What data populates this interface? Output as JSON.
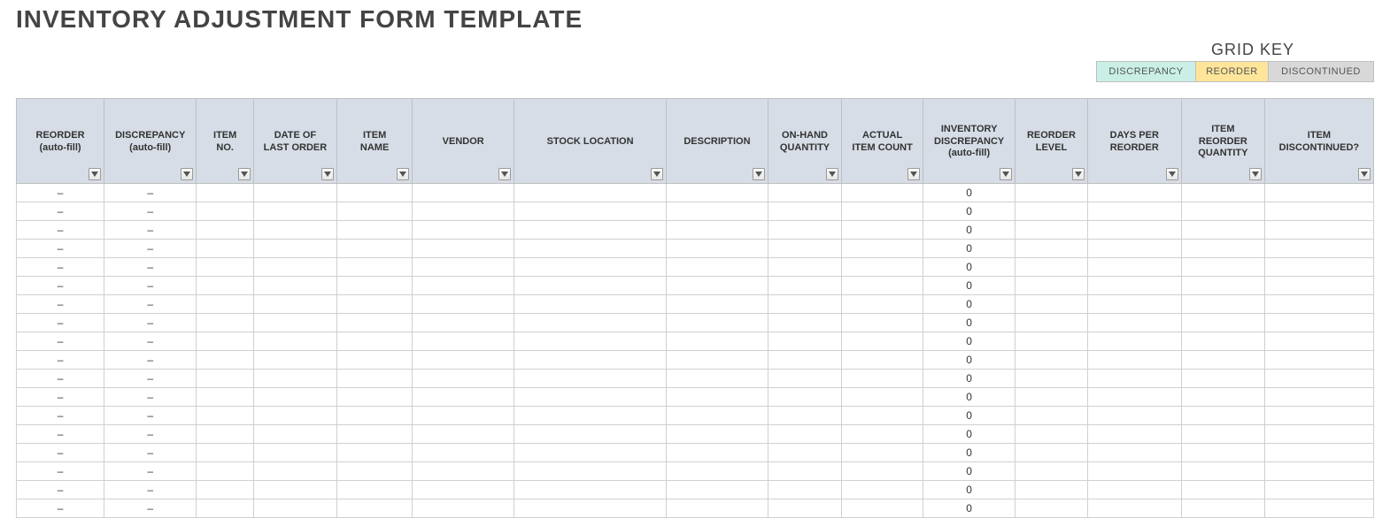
{
  "title": "INVENTORY ADJUSTMENT FORM TEMPLATE",
  "gridkey": {
    "label": "GRID KEY",
    "discrepancy": "DISCREPANCY",
    "reorder": "REORDER",
    "discontinued": "DISCONTINUED"
  },
  "columns": [
    {
      "id": "reorder_auto",
      "line1": "REORDER",
      "line2": "(auto-fill)"
    },
    {
      "id": "disc_auto",
      "line1": "DISCREPANCY",
      "line2": "(auto-fill)"
    },
    {
      "id": "item_no",
      "line1": "ITEM",
      "line2": "NO."
    },
    {
      "id": "date_last",
      "line1": "DATE OF",
      "line2": "LAST ORDER"
    },
    {
      "id": "item_name",
      "line1": "ITEM",
      "line2": "NAME"
    },
    {
      "id": "vendor",
      "line1": "VENDOR",
      "line2": ""
    },
    {
      "id": "stock_loc",
      "line1": "STOCK LOCATION",
      "line2": ""
    },
    {
      "id": "description",
      "line1": "DESCRIPTION",
      "line2": ""
    },
    {
      "id": "onhand",
      "line1": "ON-HAND",
      "line2": "QUANTITY"
    },
    {
      "id": "actual",
      "line1": "ACTUAL",
      "line2": "ITEM COUNT"
    },
    {
      "id": "inv_disc",
      "line1": "INVENTORY",
      "line2": "DISCREPANCY",
      "line3": "(auto-fill)"
    },
    {
      "id": "reorder_level",
      "line1": "REORDER",
      "line2": "LEVEL"
    },
    {
      "id": "days_reorder",
      "line1": "DAYS PER",
      "line2": "REORDER"
    },
    {
      "id": "reorder_qty",
      "line1": "ITEM",
      "line2": "REORDER",
      "line3": "QUANTITY"
    },
    {
      "id": "discontinued",
      "line1": "ITEM",
      "line2": "DISCONTINUED?"
    }
  ],
  "rows": [
    {
      "reorder_auto": "–",
      "disc_auto": "–",
      "item_no": "",
      "date_last": "",
      "item_name": "",
      "vendor": "",
      "stock_loc": "",
      "description": "",
      "onhand": "",
      "actual": "",
      "inv_disc": "0",
      "reorder_level": "",
      "days_reorder": "",
      "reorder_qty": "",
      "discontinued": ""
    },
    {
      "reorder_auto": "–",
      "disc_auto": "–",
      "item_no": "",
      "date_last": "",
      "item_name": "",
      "vendor": "",
      "stock_loc": "",
      "description": "",
      "onhand": "",
      "actual": "",
      "inv_disc": "0",
      "reorder_level": "",
      "days_reorder": "",
      "reorder_qty": "",
      "discontinued": ""
    },
    {
      "reorder_auto": "–",
      "disc_auto": "–",
      "item_no": "",
      "date_last": "",
      "item_name": "",
      "vendor": "",
      "stock_loc": "",
      "description": "",
      "onhand": "",
      "actual": "",
      "inv_disc": "0",
      "reorder_level": "",
      "days_reorder": "",
      "reorder_qty": "",
      "discontinued": ""
    },
    {
      "reorder_auto": "–",
      "disc_auto": "–",
      "item_no": "",
      "date_last": "",
      "item_name": "",
      "vendor": "",
      "stock_loc": "",
      "description": "",
      "onhand": "",
      "actual": "",
      "inv_disc": "0",
      "reorder_level": "",
      "days_reorder": "",
      "reorder_qty": "",
      "discontinued": ""
    },
    {
      "reorder_auto": "–",
      "disc_auto": "–",
      "item_no": "",
      "date_last": "",
      "item_name": "",
      "vendor": "",
      "stock_loc": "",
      "description": "",
      "onhand": "",
      "actual": "",
      "inv_disc": "0",
      "reorder_level": "",
      "days_reorder": "",
      "reorder_qty": "",
      "discontinued": ""
    },
    {
      "reorder_auto": "–",
      "disc_auto": "–",
      "item_no": "",
      "date_last": "",
      "item_name": "",
      "vendor": "",
      "stock_loc": "",
      "description": "",
      "onhand": "",
      "actual": "",
      "inv_disc": "0",
      "reorder_level": "",
      "days_reorder": "",
      "reorder_qty": "",
      "discontinued": ""
    },
    {
      "reorder_auto": "–",
      "disc_auto": "–",
      "item_no": "",
      "date_last": "",
      "item_name": "",
      "vendor": "",
      "stock_loc": "",
      "description": "",
      "onhand": "",
      "actual": "",
      "inv_disc": "0",
      "reorder_level": "",
      "days_reorder": "",
      "reorder_qty": "",
      "discontinued": ""
    },
    {
      "reorder_auto": "–",
      "disc_auto": "–",
      "item_no": "",
      "date_last": "",
      "item_name": "",
      "vendor": "",
      "stock_loc": "",
      "description": "",
      "onhand": "",
      "actual": "",
      "inv_disc": "0",
      "reorder_level": "",
      "days_reorder": "",
      "reorder_qty": "",
      "discontinued": ""
    },
    {
      "reorder_auto": "–",
      "disc_auto": "–",
      "item_no": "",
      "date_last": "",
      "item_name": "",
      "vendor": "",
      "stock_loc": "",
      "description": "",
      "onhand": "",
      "actual": "",
      "inv_disc": "0",
      "reorder_level": "",
      "days_reorder": "",
      "reorder_qty": "",
      "discontinued": ""
    },
    {
      "reorder_auto": "–",
      "disc_auto": "–",
      "item_no": "",
      "date_last": "",
      "item_name": "",
      "vendor": "",
      "stock_loc": "",
      "description": "",
      "onhand": "",
      "actual": "",
      "inv_disc": "0",
      "reorder_level": "",
      "days_reorder": "",
      "reorder_qty": "",
      "discontinued": ""
    },
    {
      "reorder_auto": "–",
      "disc_auto": "–",
      "item_no": "",
      "date_last": "",
      "item_name": "",
      "vendor": "",
      "stock_loc": "",
      "description": "",
      "onhand": "",
      "actual": "",
      "inv_disc": "0",
      "reorder_level": "",
      "days_reorder": "",
      "reorder_qty": "",
      "discontinued": ""
    },
    {
      "reorder_auto": "–",
      "disc_auto": "–",
      "item_no": "",
      "date_last": "",
      "item_name": "",
      "vendor": "",
      "stock_loc": "",
      "description": "",
      "onhand": "",
      "actual": "",
      "inv_disc": "0",
      "reorder_level": "",
      "days_reorder": "",
      "reorder_qty": "",
      "discontinued": ""
    },
    {
      "reorder_auto": "–",
      "disc_auto": "–",
      "item_no": "",
      "date_last": "",
      "item_name": "",
      "vendor": "",
      "stock_loc": "",
      "description": "",
      "onhand": "",
      "actual": "",
      "inv_disc": "0",
      "reorder_level": "",
      "days_reorder": "",
      "reorder_qty": "",
      "discontinued": ""
    },
    {
      "reorder_auto": "–",
      "disc_auto": "–",
      "item_no": "",
      "date_last": "",
      "item_name": "",
      "vendor": "",
      "stock_loc": "",
      "description": "",
      "onhand": "",
      "actual": "",
      "inv_disc": "0",
      "reorder_level": "",
      "days_reorder": "",
      "reorder_qty": "",
      "discontinued": ""
    },
    {
      "reorder_auto": "–",
      "disc_auto": "–",
      "item_no": "",
      "date_last": "",
      "item_name": "",
      "vendor": "",
      "stock_loc": "",
      "description": "",
      "onhand": "",
      "actual": "",
      "inv_disc": "0",
      "reorder_level": "",
      "days_reorder": "",
      "reorder_qty": "",
      "discontinued": ""
    },
    {
      "reorder_auto": "–",
      "disc_auto": "–",
      "item_no": "",
      "date_last": "",
      "item_name": "",
      "vendor": "",
      "stock_loc": "",
      "description": "",
      "onhand": "",
      "actual": "",
      "inv_disc": "0",
      "reorder_level": "",
      "days_reorder": "",
      "reorder_qty": "",
      "discontinued": ""
    },
    {
      "reorder_auto": "–",
      "disc_auto": "–",
      "item_no": "",
      "date_last": "",
      "item_name": "",
      "vendor": "",
      "stock_loc": "",
      "description": "",
      "onhand": "",
      "actual": "",
      "inv_disc": "0",
      "reorder_level": "",
      "days_reorder": "",
      "reorder_qty": "",
      "discontinued": ""
    },
    {
      "reorder_auto": "–",
      "disc_auto": "–",
      "item_no": "",
      "date_last": "",
      "item_name": "",
      "vendor": "",
      "stock_loc": "",
      "description": "",
      "onhand": "",
      "actual": "",
      "inv_disc": "0",
      "reorder_level": "",
      "days_reorder": "",
      "reorder_qty": "",
      "discontinued": ""
    }
  ]
}
